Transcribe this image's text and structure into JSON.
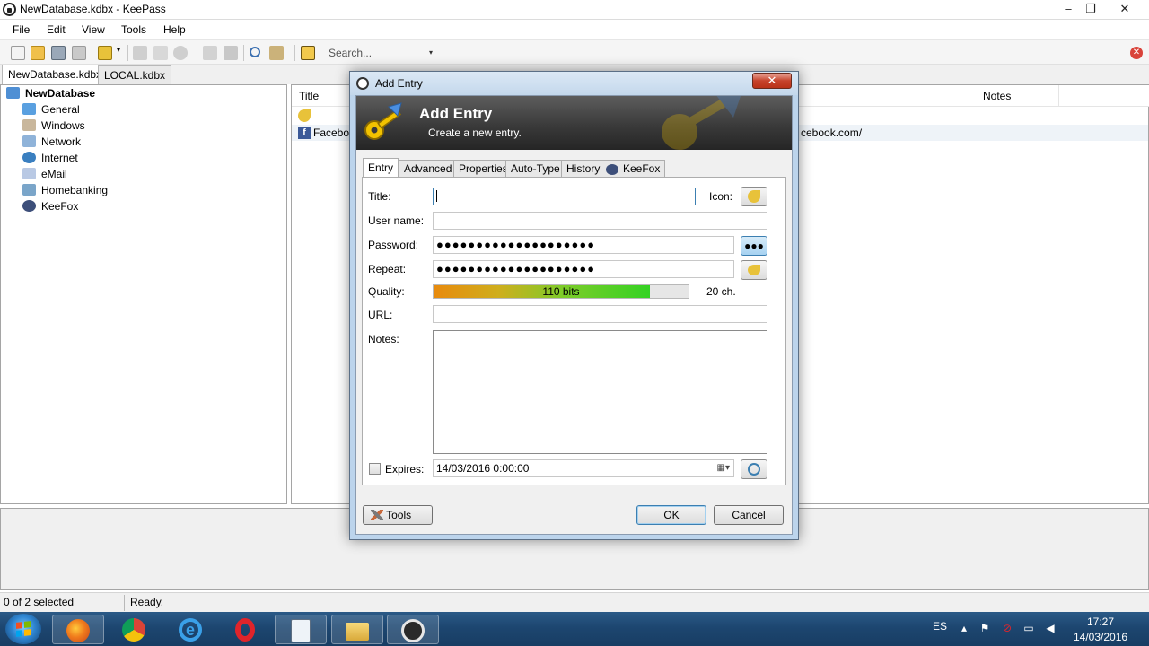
{
  "window": {
    "title": "NewDatabase.kdbx - KeePass",
    "minimize": "–",
    "maximize": "❒",
    "close": "✕"
  },
  "menu": [
    "File",
    "Edit",
    "View",
    "Tools",
    "Help"
  ],
  "toolbar": {
    "search_placeholder": "Search...",
    "search_arrow": "▾",
    "close_db": "✕"
  },
  "doc_tabs": [
    "NewDatabase.kdbx",
    "LOCAL.kdbx"
  ],
  "tree": {
    "root": "NewDatabase",
    "groups": [
      "General",
      "Windows",
      "Network",
      "Internet",
      "eMail",
      "Homebanking",
      "KeeFox"
    ]
  },
  "list": {
    "col_title": "Title",
    "col_notes": "Notes",
    "rows": [
      {
        "title": "",
        "url": ""
      },
      {
        "title": "Faceboo",
        "url": "cebook.com/"
      }
    ]
  },
  "status": {
    "selection": "0 of 2 selected",
    "state": "Ready."
  },
  "dialog": {
    "title": "Add Entry",
    "close": "✕",
    "banner_title": "Add Entry",
    "banner_subtitle": "Create a new entry.",
    "tabs": [
      "Entry",
      "Advanced",
      "Properties",
      "Auto-Type",
      "History",
      "KeeFox"
    ],
    "labels": {
      "title": "Title:",
      "icon": "Icon:",
      "username": "User name:",
      "password": "Password:",
      "repeat": "Repeat:",
      "quality": "Quality:",
      "url": "URL:",
      "notes": "Notes:",
      "expires": "Expires:"
    },
    "values": {
      "title": "",
      "username": "",
      "password": "●●●●●●●●●●●●●●●●●●●●",
      "repeat": "●●●●●●●●●●●●●●●●●●●●",
      "url": "",
      "notes": "",
      "expires_date": "14/03/2016   0:00:00",
      "expires_checked": false
    },
    "quality": {
      "bits_label": "110 bits",
      "length_label": "20 ch.",
      "fill_fraction": 0.85
    },
    "buttons": {
      "show_password": "●●●",
      "generate": "",
      "tools": "Tools",
      "ok": "OK",
      "cancel": "Cancel"
    }
  },
  "taskbar": {
    "language": "ES",
    "time": "17:27",
    "date": "14/03/2016",
    "apps": [
      "firefox-icon",
      "chrome-icon",
      "internet-explorer-icon",
      "opera-icon",
      "notepad-icon",
      "explorer-icon",
      "keepass-icon"
    ]
  },
  "colors": {
    "taskbar": "#1d4670",
    "selection": "#eef3f8",
    "quality_start": "#e88a0d",
    "quality_end": "#34d223",
    "dialog_frame": "#bcd4ec"
  }
}
